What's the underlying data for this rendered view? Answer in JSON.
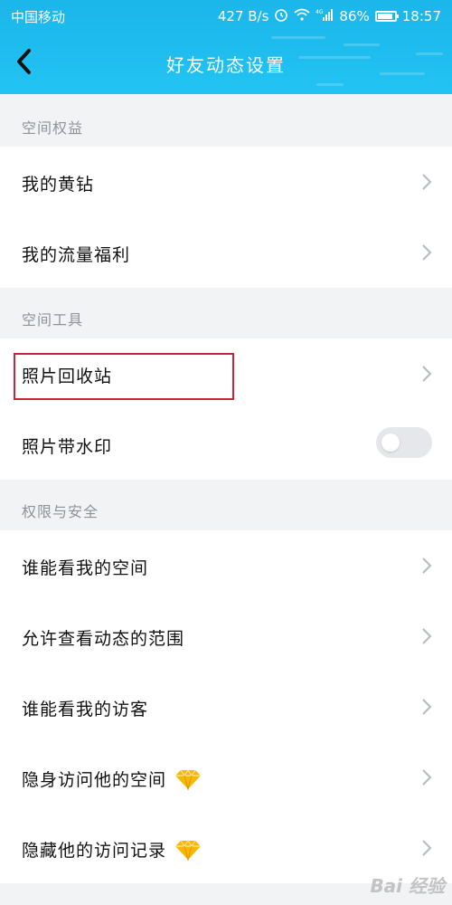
{
  "status_bar": {
    "carrier": "中国移动",
    "speed": "427 B/s",
    "battery": "86%",
    "time": "18:57",
    "icons": [
      "alarm-icon",
      "wifi-icon",
      "signal-icon",
      "battery-icon"
    ]
  },
  "header": {
    "title": "好友动态设置",
    "back_icon": "back-arrow-icon",
    "color": "#1bb6ea"
  },
  "sections": [
    {
      "title": "空间权益",
      "items": [
        {
          "label": "我的黄钻"
        },
        {
          "label": "我的流量福利"
        }
      ]
    },
    {
      "title": "空间工具",
      "items": [
        {
          "label": "照片回收站",
          "highlighted": true
        },
        {
          "label": "照片带水印",
          "toggle": false
        }
      ]
    },
    {
      "title": "权限与安全",
      "items": [
        {
          "label": "谁能看我的空间"
        },
        {
          "label": "允许查看动态的范围"
        },
        {
          "label": "谁能看我的访客"
        },
        {
          "label": "隐身访问他的空间",
          "icon": "diamond-icon"
        },
        {
          "label": "隐藏他的访问记录",
          "icon": "diamond-icon"
        }
      ]
    }
  ],
  "watermark": "Bai 经验",
  "highlight_color": "#c8243a"
}
